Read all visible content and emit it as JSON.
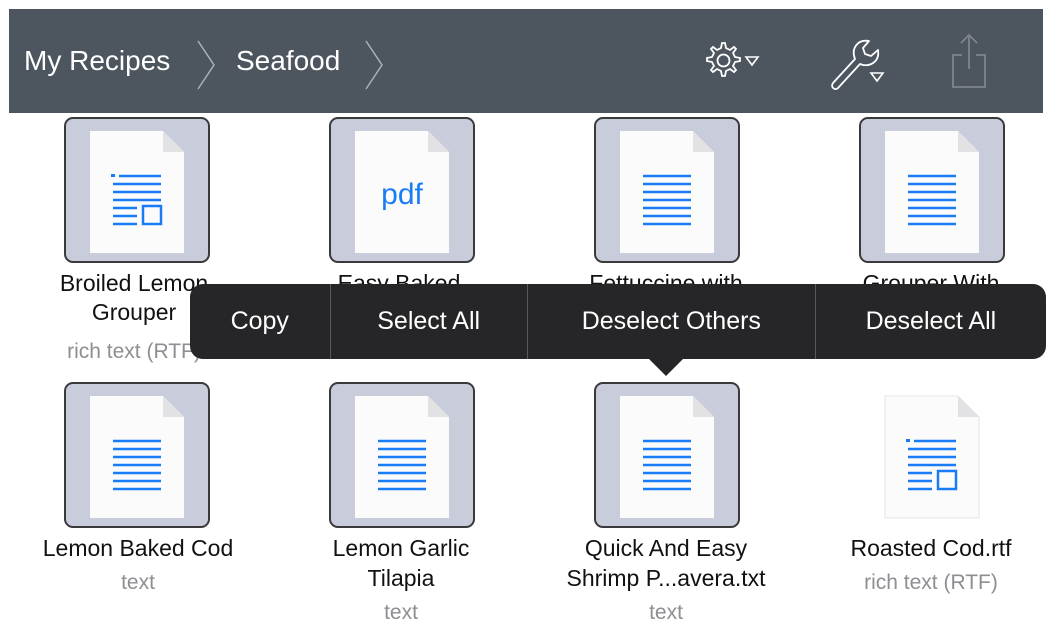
{
  "breadcrumb": [
    "My Recipes",
    "Seafood"
  ],
  "toolbar": {
    "icons": [
      "gear-dropdown-icon",
      "wrench-dropdown-icon",
      "share-icon"
    ]
  },
  "files": [
    {
      "name_lines": [
        "Broiled Lemon",
        "Grouper"
      ],
      "kind": "rich text (RTF)",
      "icon": "rtf-doc-icon"
    },
    {
      "name_lines": [
        "Easy Baked",
        ""
      ],
      "kind": "",
      "icon": "pdf-doc-icon",
      "badge": "pdf"
    },
    {
      "name_lines": [
        "Fettuccine with",
        ""
      ],
      "kind": "",
      "icon": "text-doc-icon"
    },
    {
      "name_lines": [
        "Grouper With",
        ""
      ],
      "kind": "",
      "icon": "text-doc-icon"
    },
    {
      "name_lines": [
        "Lemon Baked Cod",
        ""
      ],
      "kind": "text",
      "icon": "text-doc-icon"
    },
    {
      "name_lines": [
        "Lemon Garlic",
        "Tilapia"
      ],
      "kind": "text",
      "icon": "text-doc-icon"
    },
    {
      "name_lines": [
        "Quick And Easy",
        "Shrimp P...avera.txt"
      ],
      "kind": "text",
      "icon": "text-doc-icon"
    },
    {
      "name_lines": [
        "Roasted Cod.rtf",
        ""
      ],
      "kind": "rich text (RTF)",
      "icon": "rtf-doc-icon"
    }
  ],
  "context_menu": [
    "Copy",
    "Select All",
    "Deselect Others",
    "Deselect All"
  ],
  "colors": {
    "toolbar": "#4d555f",
    "selection": "#c9ccda",
    "accent": "#1a7cf5",
    "menu": "#262628"
  }
}
